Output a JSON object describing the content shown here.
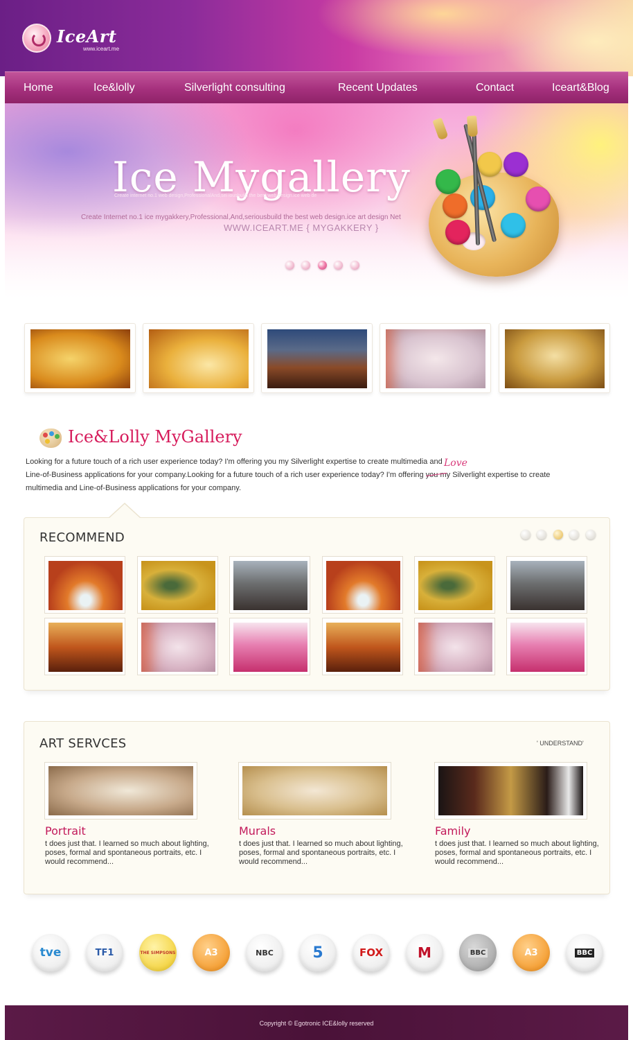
{
  "brand": {
    "name": "IceArt",
    "url": "www.iceart.me"
  },
  "nav": {
    "items": [
      {
        "label": "Home"
      },
      {
        "label": "Ice&lolly"
      },
      {
        "label": "Silverlight consulting"
      },
      {
        "label": "Recent Updates"
      },
      {
        "label": "Contact"
      },
      {
        "label": "Iceart&Blog"
      }
    ]
  },
  "banner": {
    "title": "Ice Mygallery",
    "micro_text": "Create internet no.1 web design,ProfessionalAnd,sei                                          iousbuild the best web design.ice web de",
    "subtitle": "Create Internet no.1 ice mygakkery,Professional,And,seriousbuild the best web design.ice art design Net",
    "url_text": "WWW.ICEART.ME { MYGAKKERY }",
    "slide_count": 5,
    "active_slide": 3
  },
  "gallery": {
    "title": "Ice&Lolly MyGallery",
    "text_line1": "Looking for a future touch of a rich user experience today? I'm offering you my Silverlight expertise to create multimedia and",
    "text_line2": "Line-of-Business applications for your company.Looking for a future touch of a rich user experience today? I'm offering  you  my Silverlight expertise to create",
    "text_line3": "multimedia and Line-of-Business applications for  your company.",
    "handwritten": "Love"
  },
  "recommend": {
    "title": "RECOMMEND",
    "page_count": 5,
    "active_page": 3
  },
  "services": {
    "title": "ART SERVCES",
    "link": "' UNDERSTAND'",
    "items": [
      {
        "title": "Portrait",
        "desc": "t does just that. I learned so much about lighting, poses, formal and spontaneous portraits, etc. I would recommend..."
      },
      {
        "title": "Murals",
        "desc": "t does just that. I learned so much about lighting, poses, formal and spontaneous portraits, etc. I would recommend..."
      },
      {
        "title": "Family",
        "desc": "t does just that. I learned so much about lighting, poses, formal and spontaneous portraits, etc. I would recommend..."
      }
    ]
  },
  "partners": [
    {
      "label": "tve",
      "icon": "tve-logo-icon"
    },
    {
      "label": "TF1",
      "icon": "tf1-logo-icon"
    },
    {
      "label": "THE SIMPSONS",
      "icon": "simpsons-logo-icon"
    },
    {
      "label": "A3",
      "icon": "antena3-logo-icon"
    },
    {
      "label": "NBC",
      "icon": "nbc-logo-icon"
    },
    {
      "label": "5",
      "icon": "telecinco-logo-icon"
    },
    {
      "label": "FOX",
      "icon": "fox-logo-icon"
    },
    {
      "label": "M",
      "icon": "m6-logo-icon"
    },
    {
      "label": "BBC",
      "icon": "bbc-logo-icon"
    },
    {
      "label": "A3",
      "icon": "antena3-logo-icon"
    },
    {
      "label": "BBC",
      "icon": "bbc-logo-icon"
    }
  ],
  "footer": {
    "copyright": "Copyright © Egotronic ICE&lolly reserved"
  },
  "colors": {
    "nav": "#a5307d",
    "accent_pink": "#d61b5b",
    "footer": "#4a1238",
    "panel_bg": "#fdfbf3"
  }
}
